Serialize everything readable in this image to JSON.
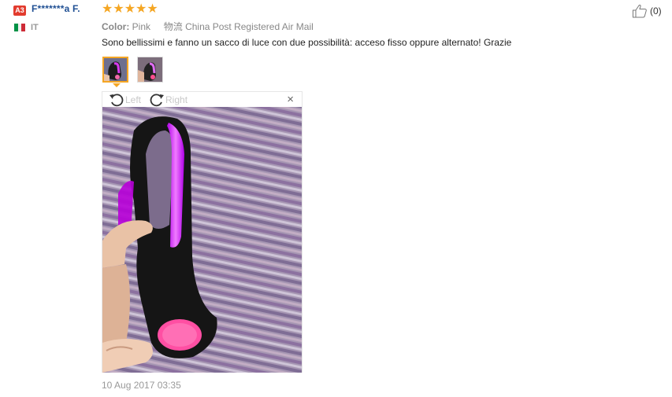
{
  "review": {
    "level_badge": "A3",
    "reviewer_name": "F*******a F.",
    "country": "IT",
    "flag_colors": [
      "#009246",
      "#ffffff",
      "#ce2b37"
    ],
    "stars": "★★★★★",
    "rating": 5,
    "helpful_count": "(0)",
    "attributes": [
      {
        "key": "Color:",
        "value": "Pink"
      },
      {
        "key": "物流",
        "value": "China Post Registered Air Mail"
      }
    ],
    "text": "Sono bellissimi e fanno un sacco di luce con due possibilità: acceso fisso oppure alternato! Grazie",
    "viewer": {
      "rotate_left": "Left",
      "rotate_right": "Right",
      "close": "×"
    },
    "date": "10 Aug 2017 03:35"
  },
  "colors": {
    "accent_star": "#f5a623",
    "name_link": "#1f4f93",
    "badge": "#e23b2e"
  }
}
